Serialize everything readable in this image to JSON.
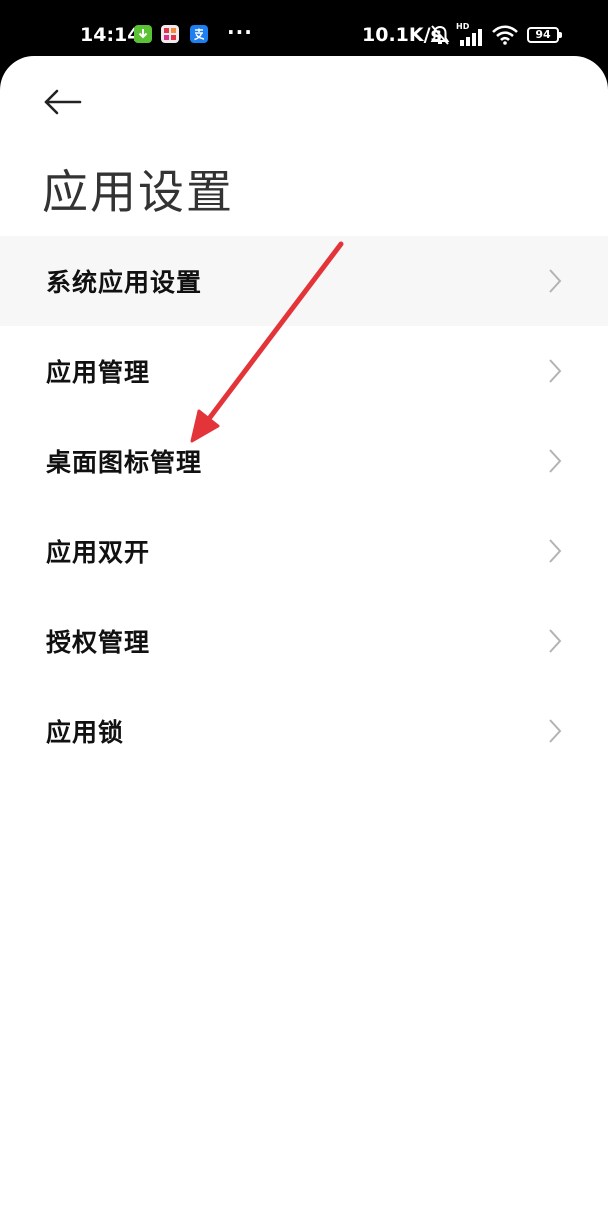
{
  "status_bar": {
    "time": "14:14",
    "more": "···",
    "net_speed": "10.1K/s",
    "hd": "HD",
    "battery": "94",
    "icons": [
      "download-app-icon",
      "red-app-icon",
      "alipay-icon",
      "bell-muted-icon",
      "signal-icon",
      "wifi-icon",
      "battery-icon"
    ]
  },
  "header": {
    "back_icon": "arrow-left-icon",
    "title": "应用设置"
  },
  "menu": {
    "items": [
      {
        "label": "系统应用设置"
      },
      {
        "label": "应用管理"
      },
      {
        "label": "桌面图标管理"
      },
      {
        "label": "应用双开"
      },
      {
        "label": "授权管理"
      },
      {
        "label": "应用锁"
      }
    ],
    "chevron_icon": "chevron-right-icon"
  },
  "colors": {
    "background": "#ffffff",
    "status_bar": "#000000",
    "text": "#111111",
    "title": "#333333",
    "chevron": "#b3b3b3",
    "annotation_arrow": "#e3343a"
  }
}
